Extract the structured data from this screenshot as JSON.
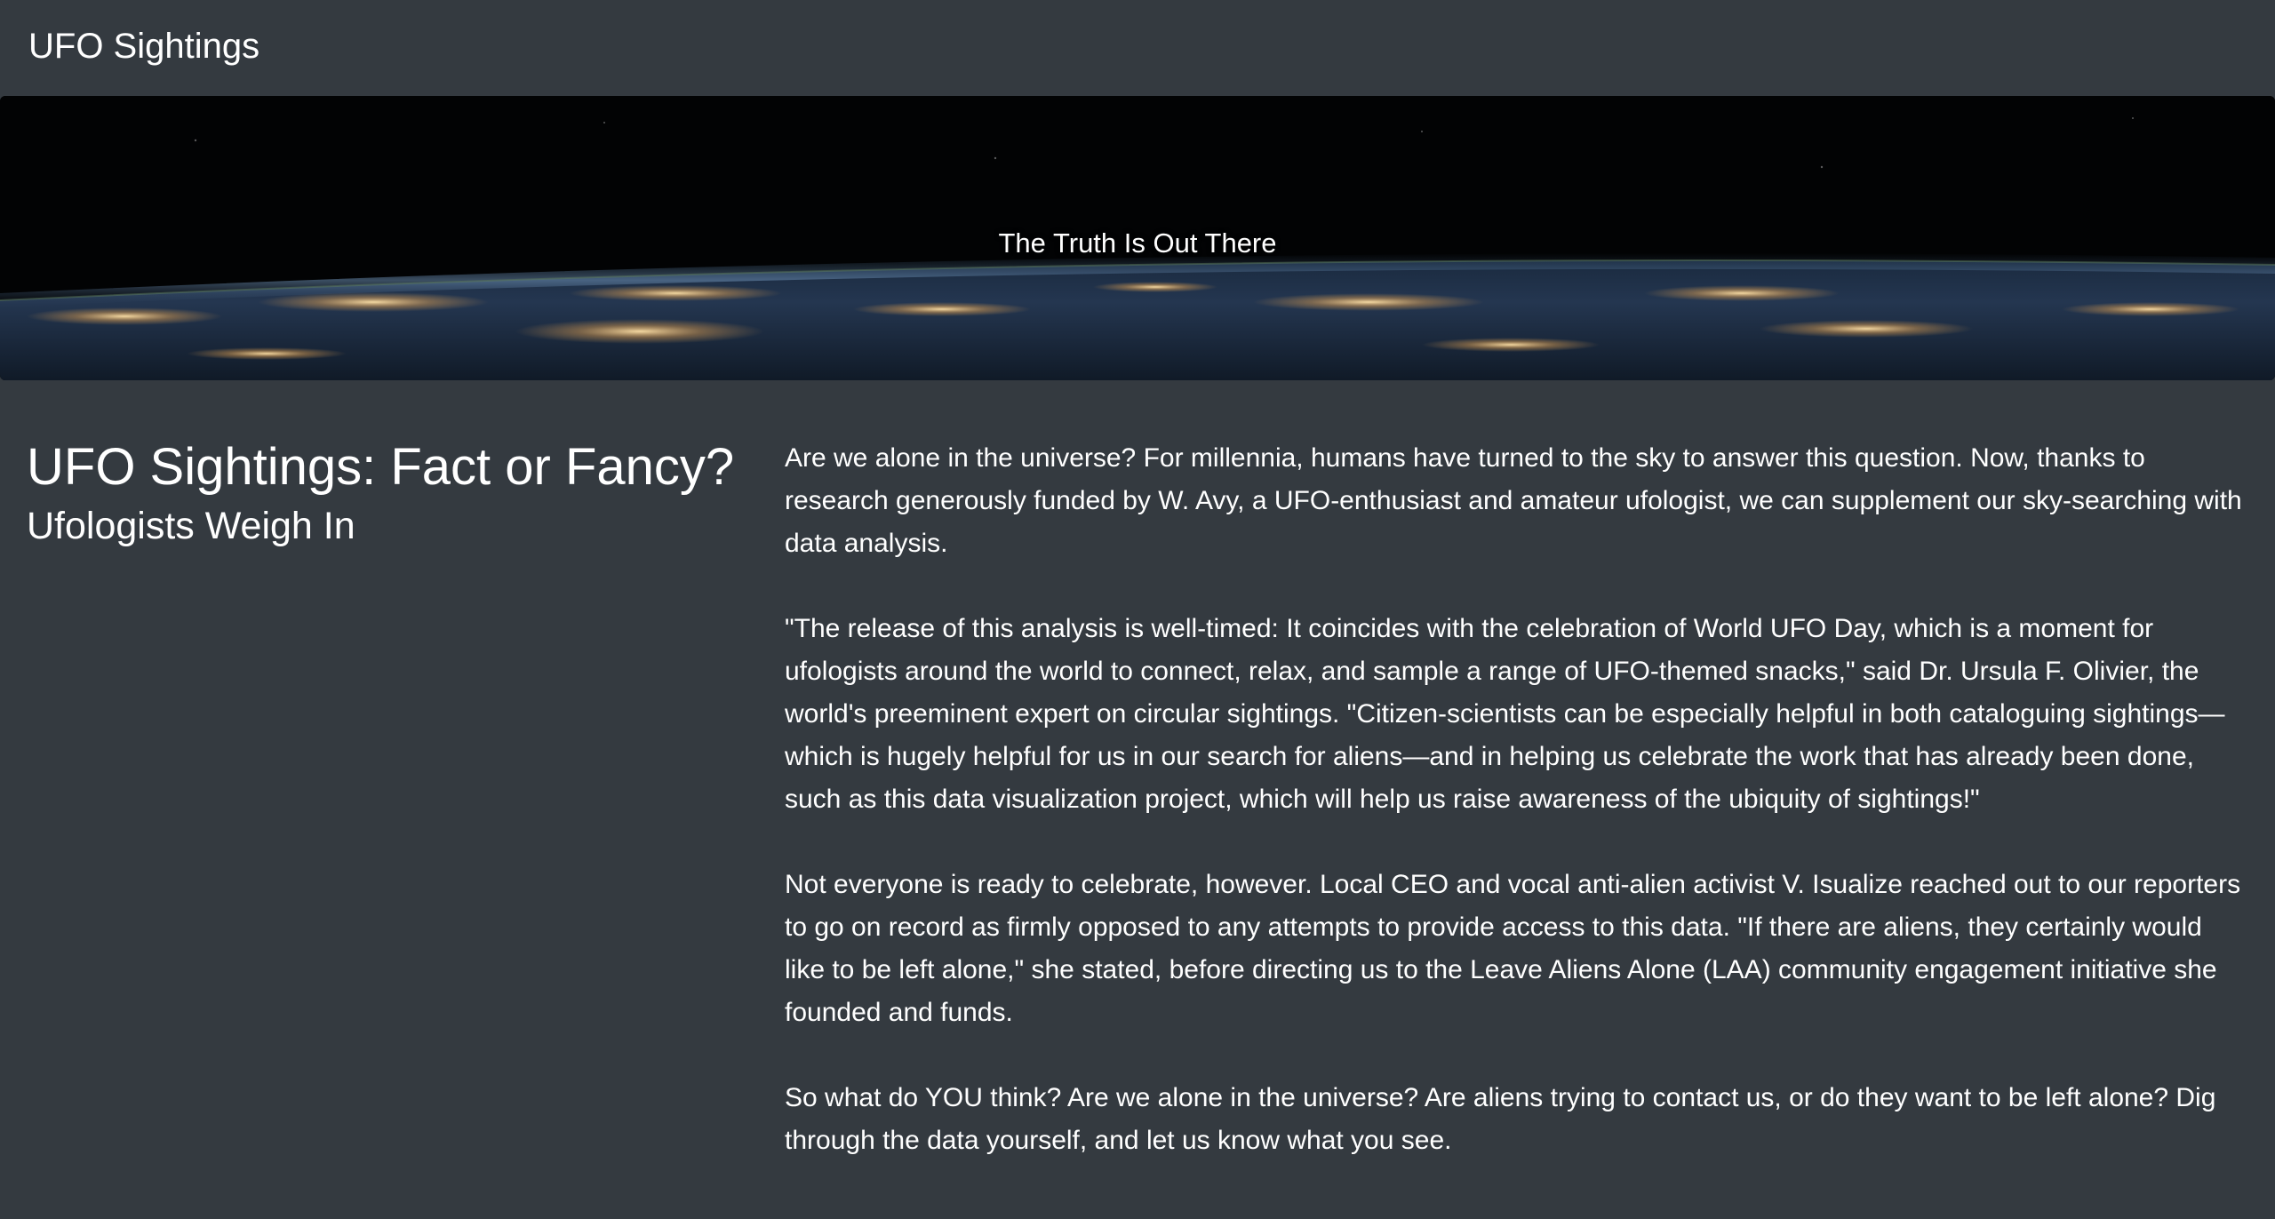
{
  "navbar": {
    "brand": "UFO Sightings"
  },
  "hero": {
    "tagline": "The Truth Is Out There"
  },
  "article": {
    "title": "UFO Sightings: Fact or Fancy?",
    "subtitle": "Ufologists Weigh In",
    "paragraphs": [
      "Are we alone in the universe? For millennia, humans have turned to the sky to answer this question. Now, thanks to research generously funded by W. Avy, a UFO-enthusiast and amateur ufologist, we can supplement our sky-searching with data analysis.",
      "\"The release of this analysis is well-timed: It coincides with the celebration of World UFO Day, which is a moment for ufologists around the world to connect, relax, and sample a range of UFO-themed snacks,\" said Dr. Ursula F. Olivier, the world's preeminent expert on circular sightings. \"Citizen-scientists can be especially helpful in both cataloguing sightings—which is hugely helpful for us in our search for aliens—and in helping us celebrate the work that has already been done, such as this data visualization project, which will help us raise awareness of the ubiquity of sightings!\"",
      "Not everyone is ready to celebrate, however. Local CEO and vocal anti-alien activist V. Isualize reached out to our reporters to go on record as firmly opposed to any attempts to provide access to this data. \"If there are aliens, they certainly would like to be left alone,\" she stated, before directing us to the Leave Aliens Alone (LAA) community engagement initiative she founded and funds.",
      "So what do YOU think? Are we alone in the universe? Are aliens trying to contact us, or do they want to be left alone? Dig through the data yourself, and let us know what you see."
    ]
  },
  "colors": {
    "background": "#343a40",
    "text": "#ffffff"
  }
}
